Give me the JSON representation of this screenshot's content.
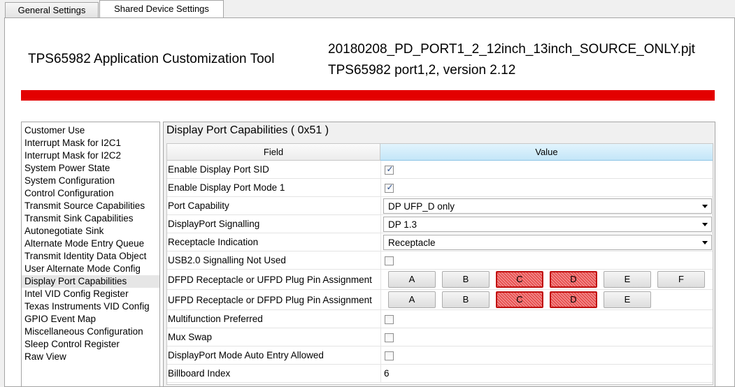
{
  "tabs": [
    "General Settings",
    "Shared Device Settings"
  ],
  "header": {
    "app_title": "TPS65982 Application Customization Tool",
    "project_file": "20180208_PD_PORT1_2_12inch_13inch_SOURCE_ONLY.pjt",
    "project_version": "TPS65982 port1,2, version 2.12",
    "accent_color": "#e30000"
  },
  "sidebar": {
    "selected": "Display Port Capabilities",
    "items": [
      "Customer Use",
      "Interrupt Mask for I2C1",
      "Interrupt Mask for I2C2",
      "System Power State",
      "System Configuration",
      "Control Configuration",
      "Transmit Source Capabilities",
      "Transmit Sink Capabilities",
      "Autonegotiate Sink",
      "Alternate Mode Entry Queue",
      "Transmit Identity Data Object",
      "User Alternate Mode Config",
      "Display Port Capabilities",
      "Intel VID Config Register",
      "Texas Instruments VID Config",
      "GPIO Event Map",
      "Miscellaneous Configuration",
      "Sleep Control Register",
      "Raw View"
    ]
  },
  "panel": {
    "title": "Display Port Capabilities  ( 0x51 )",
    "col_field": "Field",
    "col_value": "Value",
    "rows": [
      {
        "label": "Enable Display Port SID",
        "type": "checkbox",
        "checked": true
      },
      {
        "label": "Enable Display Port Mode 1",
        "type": "checkbox",
        "checked": true
      },
      {
        "label": "Port Capability",
        "type": "select",
        "value": "DP UFP_D only"
      },
      {
        "label": "DisplayPort Signalling",
        "type": "select",
        "value": "DP 1.3"
      },
      {
        "label": "Receptacle Indication",
        "type": "select",
        "value": "Receptacle"
      },
      {
        "label": "USB2.0 Signalling Not Used",
        "type": "checkbox",
        "checked": false
      },
      {
        "label": "DFPD Receptacle or UFPD Plug Pin Assignment",
        "type": "pins",
        "pins": [
          {
            "label": "A",
            "on": false
          },
          {
            "label": "B",
            "on": false
          },
          {
            "label": "C",
            "on": true
          },
          {
            "label": "D",
            "on": true
          },
          {
            "label": "E",
            "on": false
          },
          {
            "label": "F",
            "on": false
          }
        ]
      },
      {
        "label": "UFPD Receptacle or DFPD Plug Pin Assignment",
        "type": "pins",
        "pins": [
          {
            "label": "A",
            "on": false
          },
          {
            "label": "B",
            "on": false
          },
          {
            "label": "C",
            "on": true
          },
          {
            "label": "D",
            "on": true
          },
          {
            "label": "E",
            "on": false
          }
        ]
      },
      {
        "label": "Multifunction Preferred",
        "type": "checkbox",
        "checked": false
      },
      {
        "label": "Mux Swap",
        "type": "checkbox",
        "checked": false
      },
      {
        "label": "DisplayPort Mode Auto Entry Allowed",
        "type": "checkbox",
        "checked": false
      },
      {
        "label": "Billboard Index",
        "type": "text",
        "value": "6"
      }
    ]
  }
}
